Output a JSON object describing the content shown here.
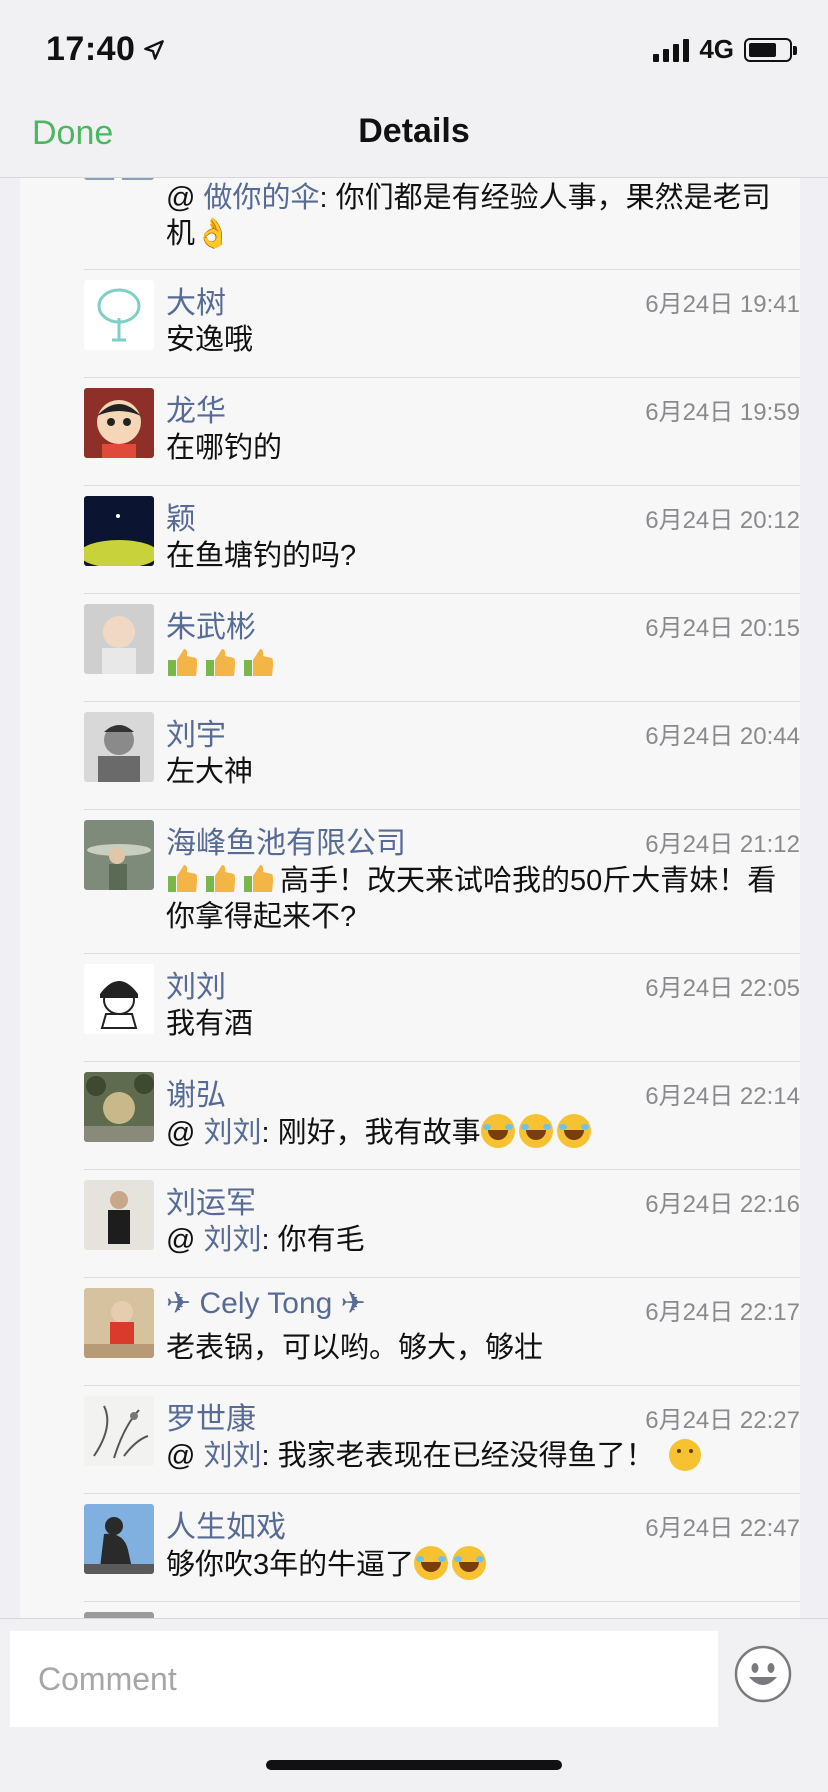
{
  "status_bar": {
    "time": "17:40",
    "location_icon": "location-arrow-icon",
    "network": "4G",
    "signal_icon": "cellular-signal-icon",
    "battery_icon": "battery-icon",
    "battery_level": 0.7
  },
  "nav": {
    "done_label": "Done",
    "title": "Details"
  },
  "comments": [
    {
      "name": "",
      "time": "",
      "mention_prefix": "@ ",
      "mention": "做你的伞",
      "text": ": 你们都是有经验人事，果然是老司机👌"
    },
    {
      "name": "大树",
      "time": "6月24日 19:41",
      "text": "安逸哦"
    },
    {
      "name": "龙华",
      "time": "6月24日 19:59",
      "text": "在哪钓的"
    },
    {
      "name": "颖",
      "time": "6月24日 20:12",
      "text": "在鱼塘钓的吗?"
    },
    {
      "name": "朱武彬",
      "time": "6月24日 20:15",
      "text": ""
    },
    {
      "name": "刘宇",
      "time": "6月24日 20:44",
      "text": "左大神"
    },
    {
      "name": "海峰鱼池有限公司",
      "time": "6月24日 21:12",
      "text": "高手！改天来试哈我的50斤大青妹！看你拿得起来不?"
    },
    {
      "name": "刘刘",
      "time": "6月24日 22:05",
      "text": "我有酒"
    },
    {
      "name": "谢弘",
      "time": "6月24日 22:14",
      "mention_prefix": "@ ",
      "mention": "刘刘",
      "text": ": 刚好，我有故事"
    },
    {
      "name": "刘运军",
      "time": "6月24日 22:16",
      "mention_prefix": "@ ",
      "mention": "刘刘",
      "text": ": 你有毛"
    },
    {
      "name": "✈ Cely Tong ✈",
      "time": "6月24日 22:17",
      "text": "老表锅，可以哟。够大，够壮"
    },
    {
      "name": "罗世康",
      "time": "6月24日 22:27",
      "mention_prefix": "@ ",
      "mention": "刘刘",
      "text": ": 我家老表现在已经没得鱼了！"
    },
    {
      "name": "人生如戏",
      "time": "6月24日 22:47",
      "text": "够你吹3年的牛逼了"
    }
  ],
  "comment_bar": {
    "placeholder": "Comment",
    "emoji_icon": "smiley-face-icon"
  },
  "colors": {
    "accent_green": "#4cb660",
    "name_blue": "#576b95",
    "time_gray": "#8a8a8e"
  }
}
